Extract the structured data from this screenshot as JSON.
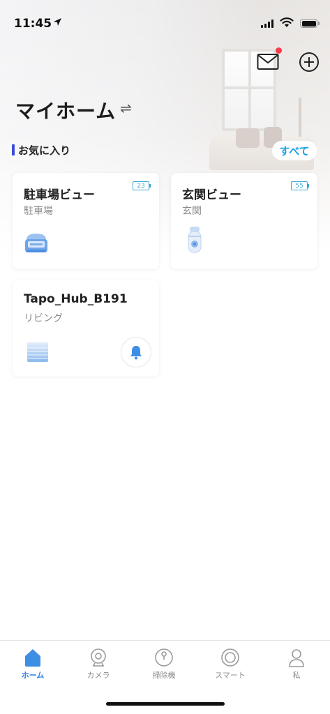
{
  "status_bar": {
    "time": "11:45"
  },
  "header": {
    "home_name": "マイホーム",
    "switch_symbol": "⇌",
    "mail_icon": "mail-icon",
    "add_icon": "plus-circle-icon"
  },
  "favorites": {
    "label": "お気に入り",
    "see_all": "すべて",
    "devices": [
      {
        "name": "駐車場ビュー",
        "room": "駐車場",
        "battery": "23",
        "icon": "camera-icon"
      },
      {
        "name": "玄関ビュー",
        "room": "玄関",
        "battery": "55",
        "icon": "bullet-camera-icon"
      },
      {
        "name": "Tapo_Hub_B191",
        "room": "リビング",
        "icon": "hub-icon",
        "action_icon": "bell-icon"
      }
    ]
  },
  "tabbar": {
    "items": [
      {
        "label": "ホーム",
        "icon": "home-icon",
        "active": true
      },
      {
        "label": "カメラ",
        "icon": "camera-icon"
      },
      {
        "label": "掃除機",
        "icon": "vacuum-icon"
      },
      {
        "label": "スマート",
        "icon": "smart-icon"
      },
      {
        "label": "私",
        "icon": "person-icon"
      }
    ]
  },
  "colors": {
    "accent": "#2f80ed",
    "see_all": "#1aa0e6",
    "notification_dot": "#ff3b4e",
    "fav_bar": "#3b4bd8",
    "battery": "#3aa9d6"
  }
}
